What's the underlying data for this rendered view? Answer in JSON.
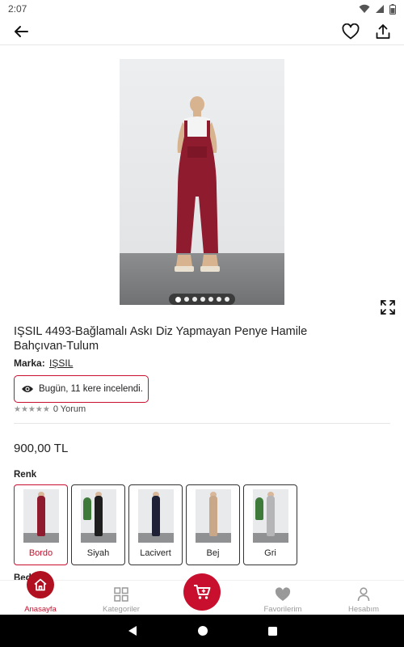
{
  "status_bar": {
    "time": "2:07"
  },
  "product": {
    "title": "IŞSIL 4493-Bağlamalı Askı Diz Yapmayan Penye Hamile Bahçıvan-Tulum",
    "brand_label": "Marka:",
    "brand_name": "IŞSIL",
    "views_text": "Bugün, 11 kere incelendi.",
    "rating_stars": "★★★★★",
    "review_count": "0 Yorum",
    "price": "900,00 TL",
    "color_label": "Renk",
    "size_label_peek": "Bed",
    "gallery": {
      "page_count": 7,
      "active_index": 0
    }
  },
  "variants": [
    {
      "label": "Bordo",
      "color": "#8e1b2e",
      "selected": true
    },
    {
      "label": "Siyah",
      "color": "#1e1e1e",
      "selected": false
    },
    {
      "label": "Lacivert",
      "color": "#1f2236",
      "selected": false
    },
    {
      "label": "Bej",
      "color": "#c9a889",
      "selected": false
    },
    {
      "label": "Gri",
      "color": "#b5b5b7",
      "selected": false
    }
  ],
  "bottom_nav": {
    "home": "Anasayfa",
    "categories": "Kategoriler",
    "favorites": "Favorilerim",
    "account": "Hesabım"
  },
  "colors": {
    "accent": "#c8102e",
    "inactive": "#999999"
  }
}
